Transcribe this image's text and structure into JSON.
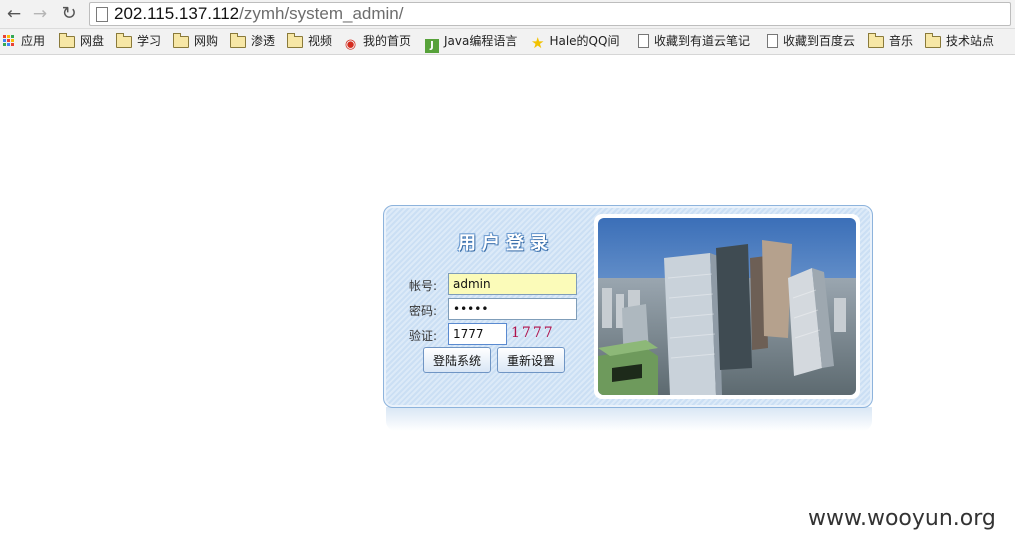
{
  "browser": {
    "url_host": "202.115.137.112",
    "url_path": "/zymh/system_admin/",
    "back_icon": "back-arrow-icon",
    "forward_icon": "forward-arrow-icon",
    "reload_icon": "reload-icon",
    "bookmarks": [
      {
        "label": "应用",
        "icon": "apps-grid-icon"
      },
      {
        "label": "网盘",
        "icon": "folder-icon"
      },
      {
        "label": "学习",
        "icon": "folder-icon"
      },
      {
        "label": "网购",
        "icon": "folder-icon"
      },
      {
        "label": "渗透",
        "icon": "folder-icon"
      },
      {
        "label": "视频",
        "icon": "folder-icon"
      },
      {
        "label": "我的首页",
        "icon": "weibo-icon"
      },
      {
        "label": "Java编程语言",
        "icon": "java-site-icon"
      },
      {
        "label": "Hale的QQ间",
        "icon": "star-icon"
      },
      {
        "label": "收藏到有道云笔记",
        "icon": "page-icon"
      },
      {
        "label": "收藏到百度云",
        "icon": "page-icon"
      },
      {
        "label": "音乐",
        "icon": "folder-icon"
      },
      {
        "label": "技术站点",
        "icon": "folder-icon"
      }
    ]
  },
  "login": {
    "title": "用户登录",
    "username_label": "帐号:",
    "username_value": "admin",
    "password_label": "密码:",
    "password_value": "•••••",
    "captcha_label": "验证:",
    "captcha_input_value": "1777",
    "captcha_image_text": "1777",
    "login_button": "登陆系统",
    "reset_button": "重新设置"
  },
  "watermark": "www.wooyun.org"
}
